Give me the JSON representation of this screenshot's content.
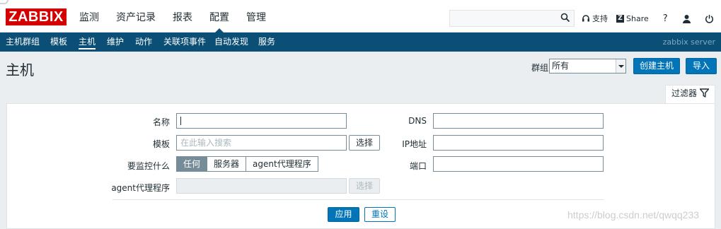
{
  "brand": {
    "logo_text": "ZABBIX",
    "logo_color": "#d40000"
  },
  "main_nav": [
    "监测",
    "资产记录",
    "报表",
    "配置",
    "管理"
  ],
  "main_nav_active": "配置",
  "search": {
    "placeholder": "",
    "icon": "search-icon"
  },
  "tools": {
    "support_label": "支持",
    "share_label": "Share",
    "help_label": "?",
    "user_icon": "user-icon",
    "logout_icon": "power-icon"
  },
  "sub_nav": [
    "主机群组",
    "模板",
    "主机",
    "维护",
    "动作",
    "关联项事件",
    "自动发现",
    "服务"
  ],
  "sub_nav_active": "主机",
  "server_name": "zabbix server",
  "page": {
    "title": "主机",
    "group_label": "群组",
    "group_value": "所有",
    "create_button": "创建主机",
    "import_button": "导入"
  },
  "filter": {
    "tab_label": "过滤器",
    "name_label": "名称",
    "name_value": "",
    "template_label": "模板",
    "template_placeholder": "在此输入搜索",
    "select_button": "选择",
    "monitored_by_label": "要监控什么",
    "monitored_by_options": [
      "任何",
      "服务器",
      "agent代理程序"
    ],
    "monitored_by_selected": "任何",
    "proxy_label": "agent代理程序",
    "proxy_select_button": "选择",
    "dns_label": "DNS",
    "dns_value": "",
    "ip_label": "IP地址",
    "ip_value": "",
    "port_label": "端口",
    "port_value": "",
    "apply_button": "应用",
    "reset_button": "重设"
  },
  "watermark": "https://blog.csdn.net/qwqq233",
  "colors": {
    "header_blue": "#0b4f77",
    "button_blue": "#0275b8",
    "background": "#ebeef0"
  }
}
